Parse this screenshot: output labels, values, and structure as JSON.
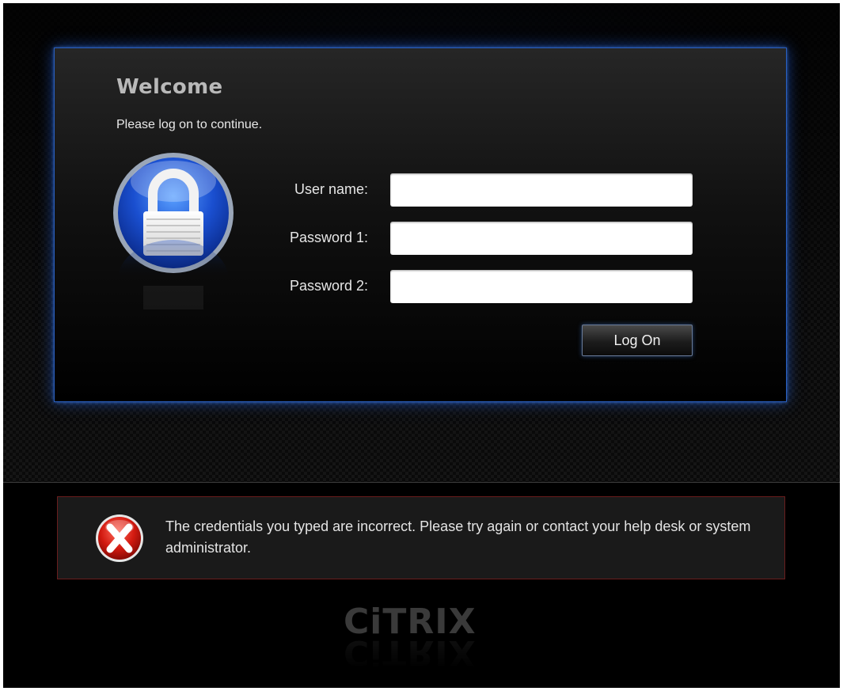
{
  "login": {
    "title": "Welcome",
    "subtitle": "Please log on to continue.",
    "fields": [
      {
        "label": "User name:",
        "value": "",
        "placeholder": ""
      },
      {
        "label": "Password 1:",
        "value": "",
        "placeholder": ""
      },
      {
        "label": "Password 2:",
        "value": "",
        "placeholder": ""
      }
    ],
    "logon_label": "Log On"
  },
  "error": {
    "message": "The credentials you typed are incorrect. Please try again or contact your help desk or system administrator."
  },
  "brand": {
    "logo_text": "CiTRIX",
    "accent": "#2a5fbf",
    "error_border": "#6a1d1d"
  },
  "icons": {
    "lock": "padlock-icon",
    "error": "error-x-icon"
  }
}
